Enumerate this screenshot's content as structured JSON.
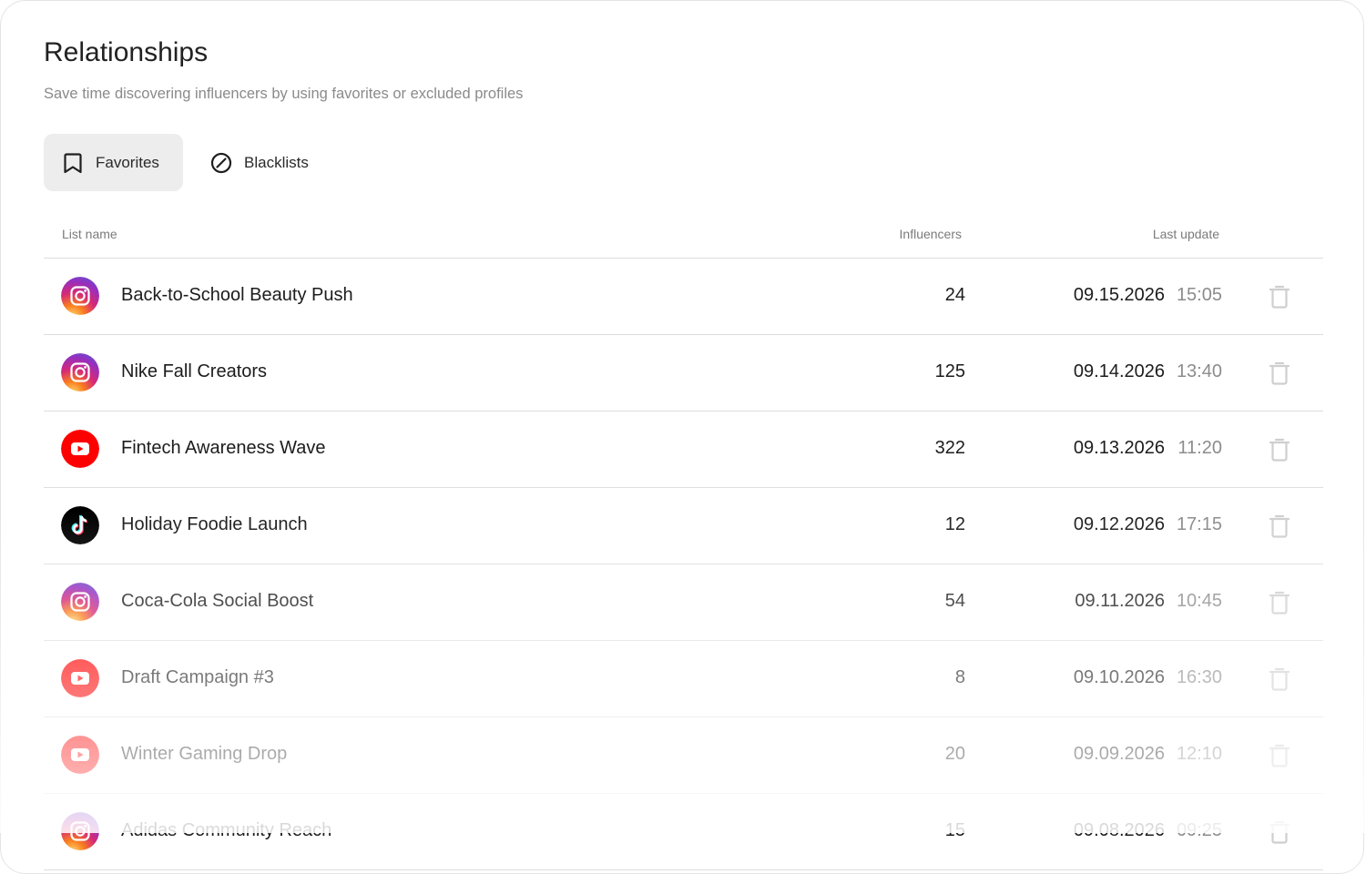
{
  "page": {
    "title": "Relationships",
    "subtitle": "Save time discovering influencers by using favorites or excluded profiles"
  },
  "tabs": {
    "favorites": {
      "label": "Favorites",
      "icon": "bookmark-icon",
      "active": true
    },
    "blacklists": {
      "label": "Blacklists",
      "icon": "block-icon",
      "active": false
    }
  },
  "table": {
    "columns": {
      "name": "List name",
      "influencers": "Influencers",
      "last_update": "Last update"
    },
    "rows": [
      {
        "platform": "instagram",
        "name": "Back-to-School Beauty Push",
        "influencers": "24",
        "date": "09.15.2026",
        "time": "15:05"
      },
      {
        "platform": "instagram",
        "name": "Nike Fall Creators",
        "influencers": "125",
        "date": "09.14.2026",
        "time": "13:40"
      },
      {
        "platform": "youtube",
        "name": "Fintech Awareness Wave",
        "influencers": "322",
        "date": "09.13.2026",
        "time": "11:20"
      },
      {
        "platform": "tiktok",
        "name": "Holiday Foodie Launch",
        "influencers": "12",
        "date": "09.12.2026",
        "time": "17:15"
      },
      {
        "platform": "instagram",
        "name": "Coca-Cola Social Boost",
        "influencers": "54",
        "date": "09.11.2026",
        "time": "10:45"
      },
      {
        "platform": "youtube",
        "name": "Draft Campaign #3",
        "influencers": "8",
        "date": "09.10.2026",
        "time": "16:30"
      },
      {
        "platform": "youtube",
        "name": "Winter Gaming Drop",
        "influencers": "20",
        "date": "09.09.2026",
        "time": "12:10"
      },
      {
        "platform": "instagram",
        "name": "Adidas Community Reach",
        "influencers": "15",
        "date": "09.08.2026",
        "time": "09:25"
      }
    ]
  },
  "colors": {
    "youtube": "#ff0000",
    "tiktok": "#000000",
    "instagram_gradient": [
      "#feda75",
      "#fa7e1e",
      "#d62976",
      "#962fbf",
      "#4f5bd5"
    ],
    "tab_active_bg": "#ededed",
    "divider": "#dedede"
  }
}
